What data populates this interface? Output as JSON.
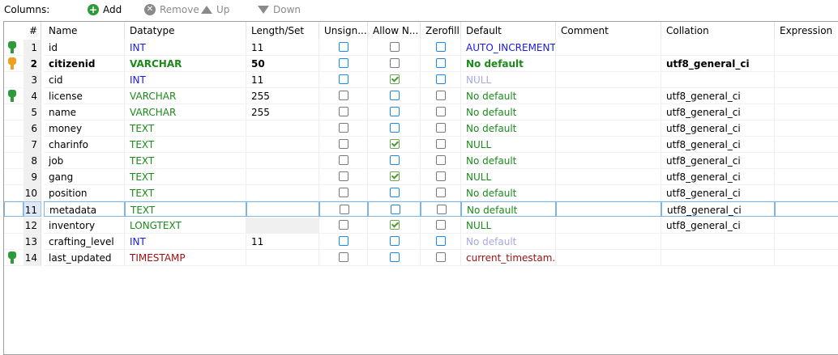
{
  "toolbar": {
    "label": "Columns:",
    "add": "Add",
    "remove": "Remove",
    "up": "Up",
    "down": "Down"
  },
  "headers": {
    "num": "#",
    "name": "Name",
    "datatype": "Datatype",
    "length": "Length/Set",
    "unsigned": "Unsign...",
    "allow_null": "Allow N...",
    "zerofill": "Zerofill",
    "default": "Default",
    "comment": "Comment",
    "collation": "Collation",
    "expression": "Expression"
  },
  "colors": {
    "key_green": "#2e9a3a",
    "key_orange": "#f0a020",
    "checkbox_blue": "#1e88e5",
    "type_int": "#1a1ae0",
    "type_text": "#1b8a1b",
    "type_timestamp": "#9a1010"
  },
  "rows": [
    {
      "num": "1",
      "name": "id",
      "type": "INT",
      "length": "11",
      "default": "AUTO_INCREMENT",
      "comment": "",
      "collation": "",
      "expression": ""
    },
    {
      "num": "2",
      "name": "citizenid",
      "type": "VARCHAR",
      "length": "50",
      "default": "No default",
      "comment": "",
      "collation": "utf8_general_ci",
      "expression": ""
    },
    {
      "num": "3",
      "name": "cid",
      "type": "INT",
      "length": "11",
      "default": "NULL",
      "comment": "",
      "collation": "",
      "expression": ""
    },
    {
      "num": "4",
      "name": "license",
      "type": "VARCHAR",
      "length": "255",
      "default": "No default",
      "comment": "",
      "collation": "utf8_general_ci",
      "expression": ""
    },
    {
      "num": "5",
      "name": "name",
      "type": "VARCHAR",
      "length": "255",
      "default": "No default",
      "comment": "",
      "collation": "utf8_general_ci",
      "expression": ""
    },
    {
      "num": "6",
      "name": "money",
      "type": "TEXT",
      "length": "",
      "default": "No default",
      "comment": "",
      "collation": "utf8_general_ci",
      "expression": ""
    },
    {
      "num": "7",
      "name": "charinfo",
      "type": "TEXT",
      "length": "",
      "default": "NULL",
      "comment": "",
      "collation": "utf8_general_ci",
      "expression": ""
    },
    {
      "num": "8",
      "name": "job",
      "type": "TEXT",
      "length": "",
      "default": "No default",
      "comment": "",
      "collation": "utf8_general_ci",
      "expression": ""
    },
    {
      "num": "9",
      "name": "gang",
      "type": "TEXT",
      "length": "",
      "default": "NULL",
      "comment": "",
      "collation": "utf8_general_ci",
      "expression": ""
    },
    {
      "num": "10",
      "name": "position",
      "type": "TEXT",
      "length": "",
      "default": "No default",
      "comment": "",
      "collation": "utf8_general_ci",
      "expression": ""
    },
    {
      "num": "11",
      "name": "metadata",
      "type": "TEXT",
      "length": "",
      "default": "No default",
      "comment": "",
      "collation": "utf8_general_ci",
      "expression": ""
    },
    {
      "num": "12",
      "name": "inventory",
      "type": "LONGTEXT",
      "length": "",
      "default": "NULL",
      "comment": "",
      "collation": "utf8_general_ci",
      "expression": ""
    },
    {
      "num": "13",
      "name": "crafting_level",
      "type": "INT",
      "length": "11",
      "default": "No default",
      "comment": "",
      "collation": "",
      "expression": ""
    },
    {
      "num": "14",
      "name": "last_updated",
      "type": "TIMESTAMP",
      "length": "",
      "default": "current_timestam...",
      "comment": "",
      "collation": "",
      "expression": ""
    }
  ]
}
